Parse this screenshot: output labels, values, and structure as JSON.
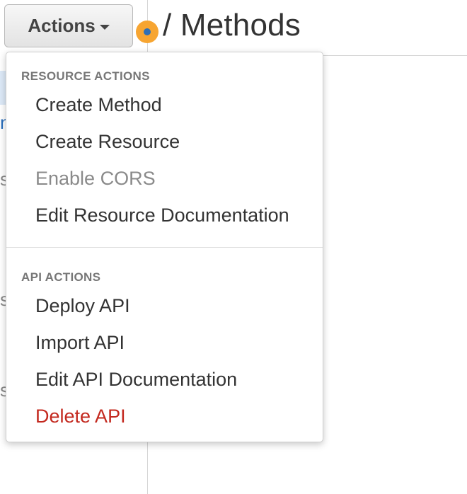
{
  "page": {
    "title": "/ Methods"
  },
  "left_panel": {
    "fragments": [
      "n",
      "s",
      "s",
      "s"
    ]
  },
  "actions_button": {
    "label": "Actions",
    "icon": "caret-down-icon"
  },
  "status_indicator": {
    "outer_color": "#f7a531",
    "inner_color": "#2f6fb5"
  },
  "menu": {
    "resource_actions": {
      "header": "RESOURCE ACTIONS",
      "items": [
        {
          "label": "Create Method",
          "state": "enabled"
        },
        {
          "label": "Create Resource",
          "state": "enabled"
        },
        {
          "label": "Enable CORS",
          "state": "disabled"
        },
        {
          "label": "Edit Resource Documentation",
          "state": "enabled"
        }
      ]
    },
    "api_actions": {
      "header": "API ACTIONS",
      "items": [
        {
          "label": "Deploy API",
          "state": "enabled"
        },
        {
          "label": "Import API",
          "state": "enabled"
        },
        {
          "label": "Edit API Documentation",
          "state": "enabled"
        },
        {
          "label": "Delete API",
          "state": "danger"
        }
      ]
    }
  },
  "colors": {
    "danger_text": "#c3281e",
    "disabled_text": "#8a8a8a",
    "link_blue": "#2a6ebb"
  }
}
